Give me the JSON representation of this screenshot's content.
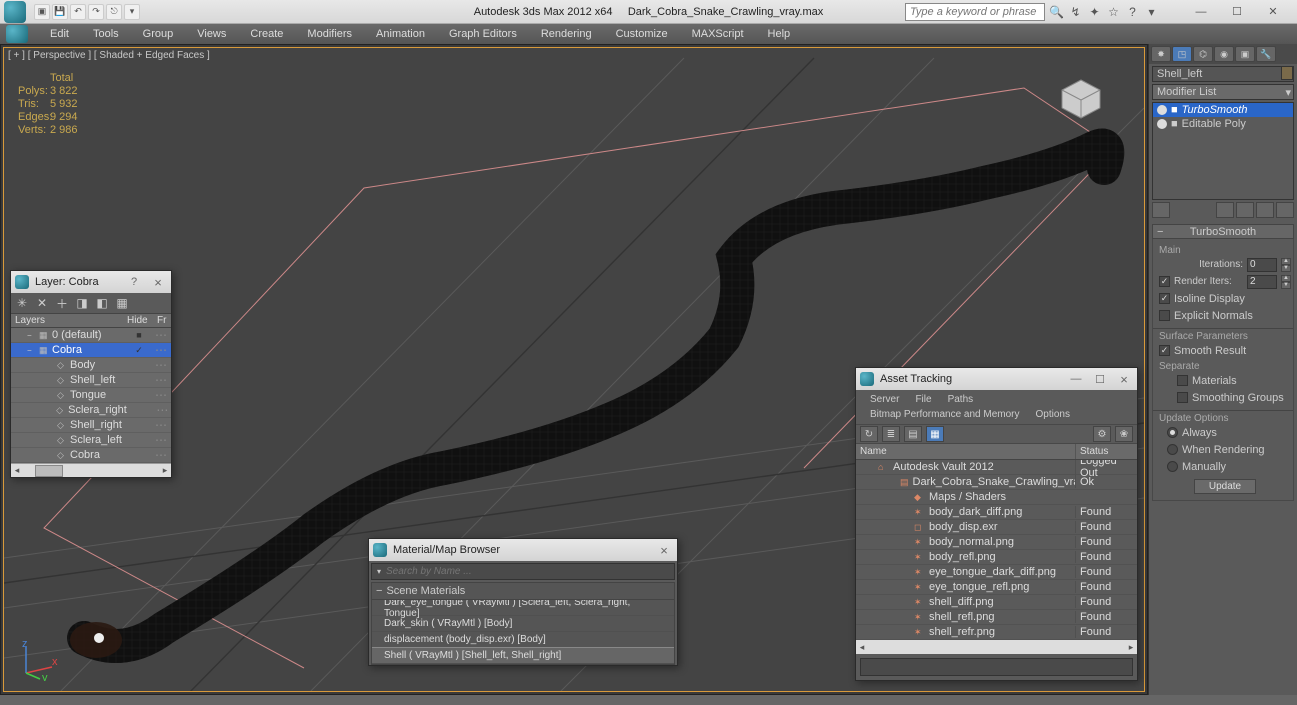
{
  "title": {
    "app": "Autodesk 3ds Max  2012 x64",
    "file": "Dark_Cobra_Snake_Crawling_vray.max"
  },
  "search_placeholder": "Type a keyword or phrase",
  "menus": [
    "Edit",
    "Tools",
    "Group",
    "Views",
    "Create",
    "Modifiers",
    "Animation",
    "Graph Editors",
    "Rendering",
    "Customize",
    "MAXScript",
    "Help"
  ],
  "viewport_label": "[ + ] [ Perspective ] [ Shaded + Edged Faces ]",
  "stats": {
    "total_label": "Total",
    "polys_label": "Polys:",
    "polys": "3 822",
    "tris_label": "Tris:",
    "tris": "5 932",
    "edges_label": "Edges:",
    "edges": "9 294",
    "verts_label": "Verts:",
    "verts": "2 986"
  },
  "cmd": {
    "object_name": "Shell_left",
    "modifier_list_label": "Modifier List",
    "stack": [
      {
        "name": "TurboSmooth",
        "sel": true
      },
      {
        "name": "Editable Poly",
        "sel": false
      }
    ],
    "rollout_turbo": "TurboSmooth",
    "main_label": "Main",
    "iterations_label": "Iterations:",
    "iterations": "0",
    "render_iters_label": "Render Iters:",
    "render_iters": "2",
    "isoline_label": "Isoline Display",
    "explicit_label": "Explicit Normals",
    "surface_params_label": "Surface Parameters",
    "smooth_result_label": "Smooth Result",
    "separate_label": "Separate",
    "materials_label": "Materials",
    "smoothing_groups_label": "Smoothing Groups",
    "update_options_label": "Update Options",
    "always_label": "Always",
    "when_rendering_label": "When Rendering",
    "manually_label": "Manually",
    "update_btn": "Update"
  },
  "layer_panel": {
    "title": "Layer: Cobra",
    "col_layers": "Layers",
    "col_hide": "Hide",
    "col_fr": "Fr",
    "rows": [
      {
        "indent": 1,
        "exp": "−",
        "name": "0 (default)",
        "hide": "■",
        "sel": false,
        "ico": "▦"
      },
      {
        "indent": 1,
        "exp": "−",
        "name": "Cobra",
        "hide": "✓",
        "sel": true,
        "ico": "▦"
      },
      {
        "indent": 2,
        "name": "Body",
        "ico": "◇"
      },
      {
        "indent": 2,
        "name": "Shell_left",
        "ico": "◇"
      },
      {
        "indent": 2,
        "name": "Tongue",
        "ico": "◇"
      },
      {
        "indent": 2,
        "name": "Sclera_right",
        "ico": "◇"
      },
      {
        "indent": 2,
        "name": "Shell_right",
        "ico": "◇"
      },
      {
        "indent": 2,
        "name": "Sclera_left",
        "ico": "◇"
      },
      {
        "indent": 2,
        "name": "Cobra",
        "ico": "◇"
      }
    ]
  },
  "mat_panel": {
    "title": "Material/Map Browser",
    "search_placeholder": "Search by Name ...",
    "group": "Scene Materials",
    "items": [
      "Dark_eye_tongue ( VRayMtl )  [Sclera_left, Sclera_right, Tongue]",
      "Dark_skin ( VRayMtl )  [Body]",
      "displacement (body_disp.exr)  [Body]",
      "Shell  ( VRayMtl )  [Shell_left, Shell_right]"
    ],
    "selected_index": 3
  },
  "asset_panel": {
    "title": "Asset Tracking",
    "menus": [
      "Server",
      "File",
      "Paths",
      "Bitmap Performance and Memory",
      "Options"
    ],
    "col_name": "Name",
    "col_status": "Status",
    "rows": [
      {
        "i": 1,
        "ico": "⌂",
        "name": "Autodesk Vault 2012",
        "status": "Logged Out"
      },
      {
        "i": 2,
        "ico": "▤",
        "name": "Dark_Cobra_Snake_Crawling_vray.max",
        "status": "Ok"
      },
      {
        "i": 3,
        "ico": "◆",
        "name": "Maps / Shaders",
        "status": ""
      },
      {
        "i": 3,
        "ico": "✶",
        "name": "body_dark_diff.png",
        "status": "Found"
      },
      {
        "i": 3,
        "ico": "◻",
        "name": "body_disp.exr",
        "status": "Found"
      },
      {
        "i": 3,
        "ico": "✶",
        "name": "body_normal.png",
        "status": "Found"
      },
      {
        "i": 3,
        "ico": "✶",
        "name": "body_refl.png",
        "status": "Found"
      },
      {
        "i": 3,
        "ico": "✶",
        "name": "eye_tongue_dark_diff.png",
        "status": "Found"
      },
      {
        "i": 3,
        "ico": "✶",
        "name": "eye_tongue_refl.png",
        "status": "Found"
      },
      {
        "i": 3,
        "ico": "✶",
        "name": "shell_diff.png",
        "status": "Found"
      },
      {
        "i": 3,
        "ico": "✶",
        "name": "shell_refl.png",
        "status": "Found"
      },
      {
        "i": 3,
        "ico": "✶",
        "name": "shell_refr.png",
        "status": "Found"
      }
    ]
  }
}
